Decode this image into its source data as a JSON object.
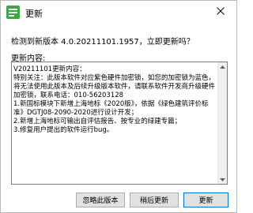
{
  "window": {
    "title": "更新",
    "icon": "app-icon",
    "close_icon": "close-icon"
  },
  "message": "检测到新版本 4.0.20211101.1957，立即更新吗？",
  "notes": {
    "label": "更新内容:",
    "lines": [
      "V20211101更新内容：",
      "特别关注：此版本软件对应紫色硬件加密锁，如您的加密锁为蓝色，将无法使用此版本及后续升级版本软件，请联系软件开发商升级硬件加密锁，联系电话：010-56203128",
      "1.新国标模块下新增上海地标《2020版》，依据《绿色建筑评价标准》DGTJ08-2090-2020进行设计开发；",
      "2.新增上海地标可输出自评估报告、按专业的绿建专篇；",
      "3.修复用户提出的软件运行bug。"
    ]
  },
  "buttons": {
    "ignore": "忽略此版本",
    "later": "稍后更新",
    "update": "更新"
  }
}
